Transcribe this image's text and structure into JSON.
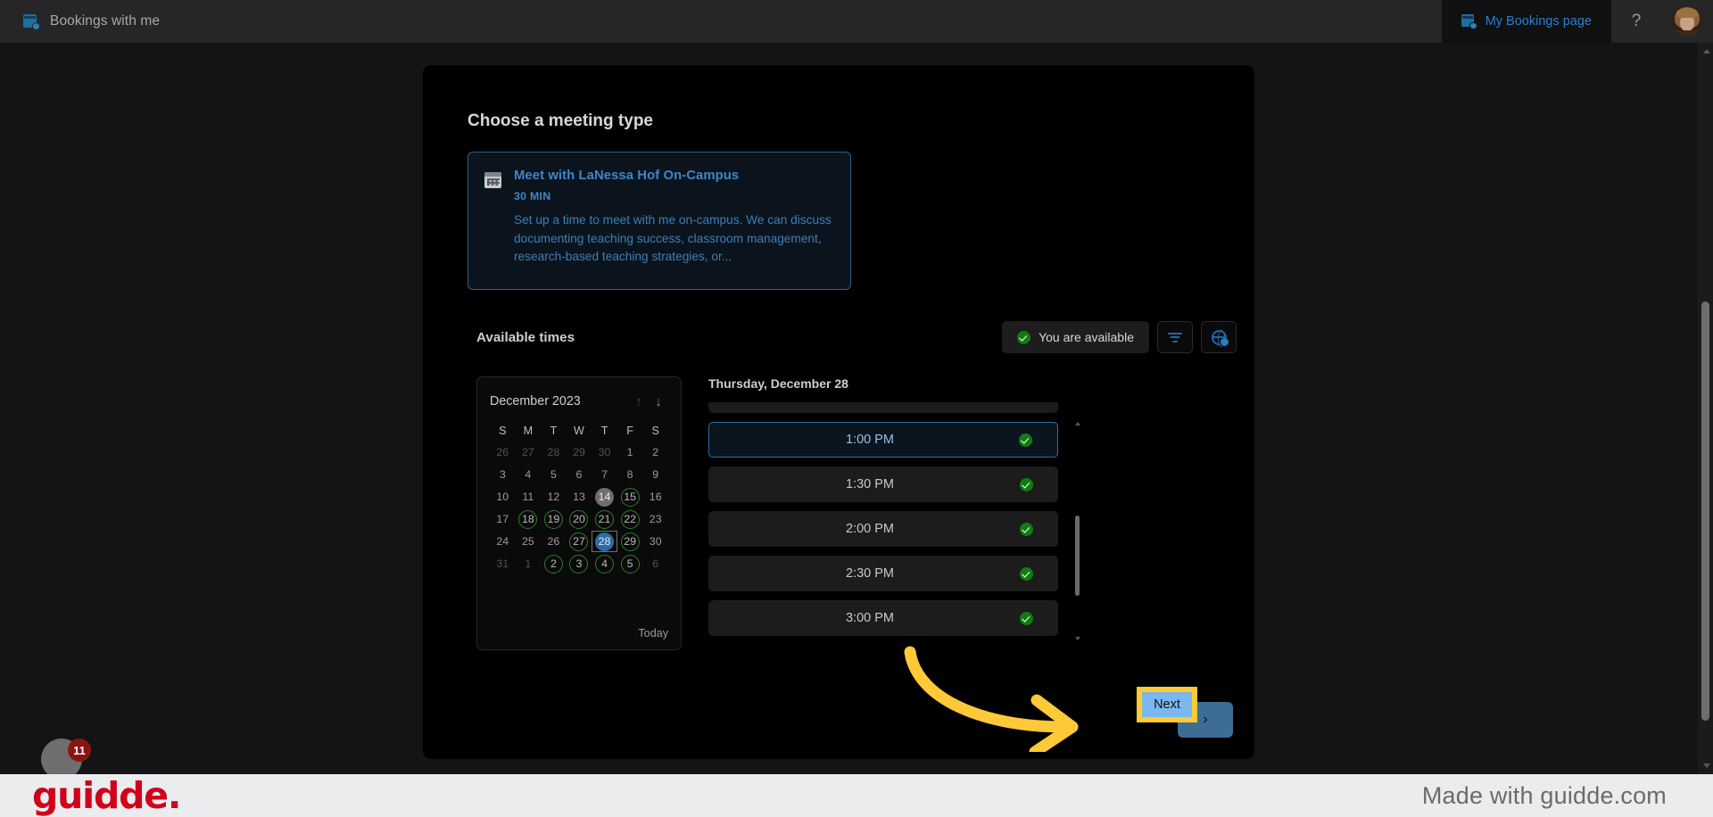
{
  "header": {
    "app_icon": "bookings-icon",
    "title": "Bookings with me",
    "my_bookings_label": "My Bookings page",
    "my_bookings_icon": "bookings-page-icon",
    "help_label": "?",
    "avatar_alt": "user-avatar"
  },
  "main": {
    "section_title": "Choose a meeting type",
    "meeting_type": {
      "icon": "calendar-icon",
      "name": "Meet with LaNessa Hof On-Campus",
      "duration": "30 MIN",
      "description": "Set up a time to meet with me on-campus. We can discuss documenting teaching success, classroom management, research-based teaching strategies, or..."
    },
    "available": {
      "title": "Available times",
      "status_badge": "You are available",
      "status_icon": "check-circle-icon",
      "filter_icon": "filter-icon",
      "timezone_icon": "globe-clock-icon"
    },
    "calendar": {
      "month_label": "December 2023",
      "prev_icon": "arrow-up-icon",
      "next_icon": "arrow-down-icon",
      "today_label": "Today",
      "day_headers": [
        "S",
        "M",
        "T",
        "W",
        "T",
        "F",
        "S"
      ],
      "weeks": [
        [
          {
            "d": "26",
            "state": "out"
          },
          {
            "d": "27",
            "state": "out"
          },
          {
            "d": "28",
            "state": "out"
          },
          {
            "d": "29",
            "state": "out"
          },
          {
            "d": "30",
            "state": "out"
          },
          {
            "d": "1",
            "state": "plain"
          },
          {
            "d": "2",
            "state": "plain"
          }
        ],
        [
          {
            "d": "3",
            "state": "plain"
          },
          {
            "d": "4",
            "state": "plain"
          },
          {
            "d": "5",
            "state": "plain"
          },
          {
            "d": "6",
            "state": "plain"
          },
          {
            "d": "7",
            "state": "plain"
          },
          {
            "d": "8",
            "state": "plain"
          },
          {
            "d": "9",
            "state": "plain"
          }
        ],
        [
          {
            "d": "10",
            "state": "plain"
          },
          {
            "d": "11",
            "state": "plain"
          },
          {
            "d": "12",
            "state": "plain"
          },
          {
            "d": "13",
            "state": "plain"
          },
          {
            "d": "14",
            "state": "today"
          },
          {
            "d": "15",
            "state": "avail"
          },
          {
            "d": "16",
            "state": "plain"
          }
        ],
        [
          {
            "d": "17",
            "state": "plain"
          },
          {
            "d": "18",
            "state": "avail"
          },
          {
            "d": "19",
            "state": "avail"
          },
          {
            "d": "20",
            "state": "avail"
          },
          {
            "d": "21",
            "state": "avail"
          },
          {
            "d": "22",
            "state": "avail"
          },
          {
            "d": "23",
            "state": "plain"
          }
        ],
        [
          {
            "d": "24",
            "state": "plain"
          },
          {
            "d": "25",
            "state": "plain"
          },
          {
            "d": "26",
            "state": "plain"
          },
          {
            "d": "27",
            "state": "avail"
          },
          {
            "d": "28",
            "state": "selected"
          },
          {
            "d": "29",
            "state": "avail"
          },
          {
            "d": "30",
            "state": "plain"
          }
        ],
        [
          {
            "d": "31",
            "state": "out"
          },
          {
            "d": "1",
            "state": "out"
          },
          {
            "d": "2",
            "state": "avail"
          },
          {
            "d": "3",
            "state": "avail"
          },
          {
            "d": "4",
            "state": "avail"
          },
          {
            "d": "5",
            "state": "avail"
          },
          {
            "d": "6",
            "state": "out"
          }
        ]
      ]
    },
    "slots": {
      "date_label": "Thursday, December 28",
      "items": [
        {
          "time": "",
          "state": "cut-off"
        },
        {
          "time": "1:00 PM",
          "state": "selected"
        },
        {
          "time": "1:30 PM",
          "state": "available"
        },
        {
          "time": "2:00 PM",
          "state": "available"
        },
        {
          "time": "2:30 PM",
          "state": "available"
        },
        {
          "time": "3:00 PM",
          "state": "available"
        }
      ]
    },
    "next_button_label": "›"
  },
  "annotation": {
    "tooltip_label": "Next",
    "arrow_color": "#ffc938",
    "tooltip_border_color": "#ffc938",
    "tooltip_fill_color": "#79b8f0"
  },
  "footer": {
    "logo": "guidde.",
    "made_with": "Made with guidde.com",
    "badge_count": "11"
  }
}
